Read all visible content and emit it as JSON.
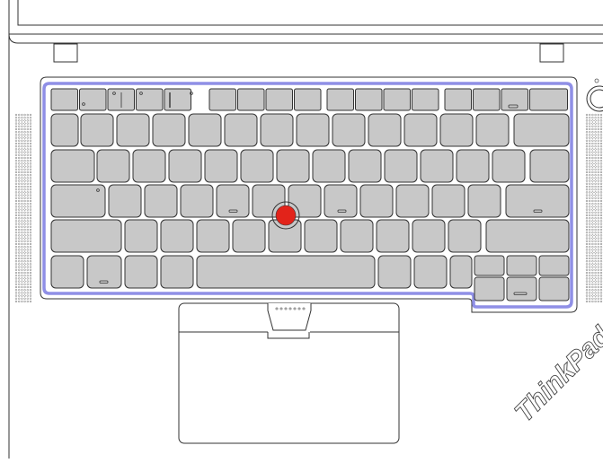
{
  "brand": {
    "logo_text": "ThinkPad"
  },
  "colors": {
    "outline": "#333333",
    "key_fill": "#c8c8c8",
    "highlight": "#8f8fe6",
    "trackpoint": "#e2231a",
    "body": "#ffffff"
  },
  "icons": {
    "trackpoint": "trackpoint-nub-icon",
    "power": "power-button-icon",
    "speaker": "speaker-grille-icon",
    "fingerprint_led": "status-led-icon"
  }
}
